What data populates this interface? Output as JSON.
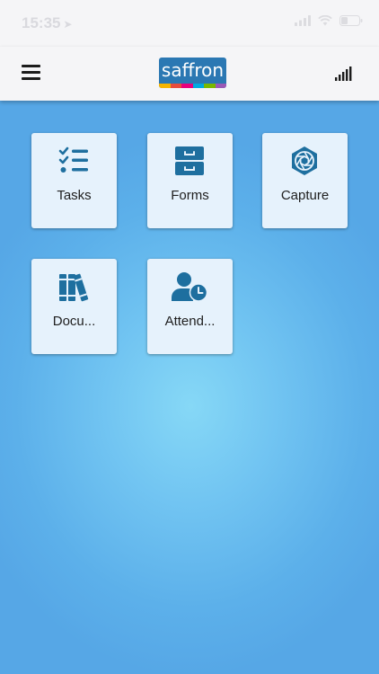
{
  "status_bar": {
    "time": "15:35",
    "location_glyph": "➤"
  },
  "header": {
    "menu_icon": "hamburger-menu-icon",
    "logo_text": "saffron",
    "logo_colors": [
      "#f5b400",
      "#e84c3d",
      "#e6007e",
      "#00a9e0",
      "#7ab800",
      "#9b59b6"
    ],
    "signal_icon": "signal-strength-icon"
  },
  "colors": {
    "tile_background": "#e6f2fc",
    "icon_color": "#1e6f9f",
    "header_background": "#f5f5f7"
  },
  "tiles": [
    {
      "label": "Tasks",
      "icon": "checklist-icon"
    },
    {
      "label": "Forms",
      "icon": "filing-cabinet-icon"
    },
    {
      "label": "Capture",
      "icon": "aperture-icon"
    },
    {
      "label": "Docu...",
      "icon": "books-icon"
    },
    {
      "label": "Attend...",
      "icon": "user-clock-icon"
    }
  ]
}
